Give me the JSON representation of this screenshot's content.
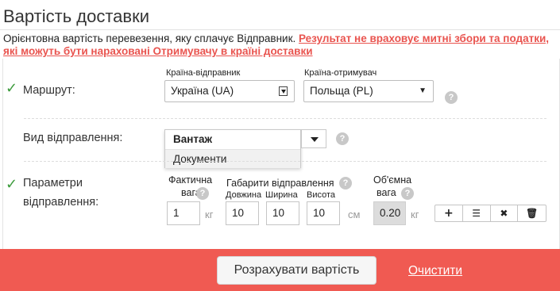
{
  "page": {
    "title": "Вартість доставки",
    "notice": "Орієнтовна вартість перевезення, яку сплачує Відправник.",
    "notice_warning": "Результат не враховує митні збори та податки, які можуть бути нараховані Отримувачу в країні доставки"
  },
  "route": {
    "label": "Маршрут:",
    "sender_country_label": "Країна-відправник",
    "sender_country_value": "Україна (UA)",
    "receiver_country_label": "Країна-отримувач",
    "receiver_country_value": "Польща (PL)",
    "help": "?"
  },
  "shipment_type": {
    "label": "Вид відправлення:",
    "options": [
      "Вантаж",
      "Документи"
    ],
    "selected": "Вантаж",
    "help": "?"
  },
  "parameters": {
    "label_line1": "Параметри",
    "label_line2": "відправлення:",
    "actual_weight_label_1": "Фактична",
    "actual_weight_label_2": "вага",
    "dimensions_label": "Габарити відправлення",
    "length_label": "Довжина",
    "width_label": "Ширина",
    "height_label": "Висота",
    "volume_weight_label_1": "Об'ємна",
    "volume_weight_label_2": "вага",
    "actual_weight_value": "1",
    "weight_unit": "кг",
    "length_value": "10",
    "width_value": "10",
    "height_value": "10",
    "dimension_unit": "см",
    "volume_weight_value": "0.20",
    "volume_unit": "кг",
    "help": "?"
  },
  "tools": {
    "add_icon": "+",
    "list_icon": "☰",
    "remove_icon": "✖",
    "delete_icon": "🗑"
  },
  "actions": {
    "calculate_label": "Розрахувати вартість",
    "clear_label": "Очистити"
  },
  "colors": {
    "accent_red": "#f05a52",
    "check_green": "#3c9b3c"
  }
}
